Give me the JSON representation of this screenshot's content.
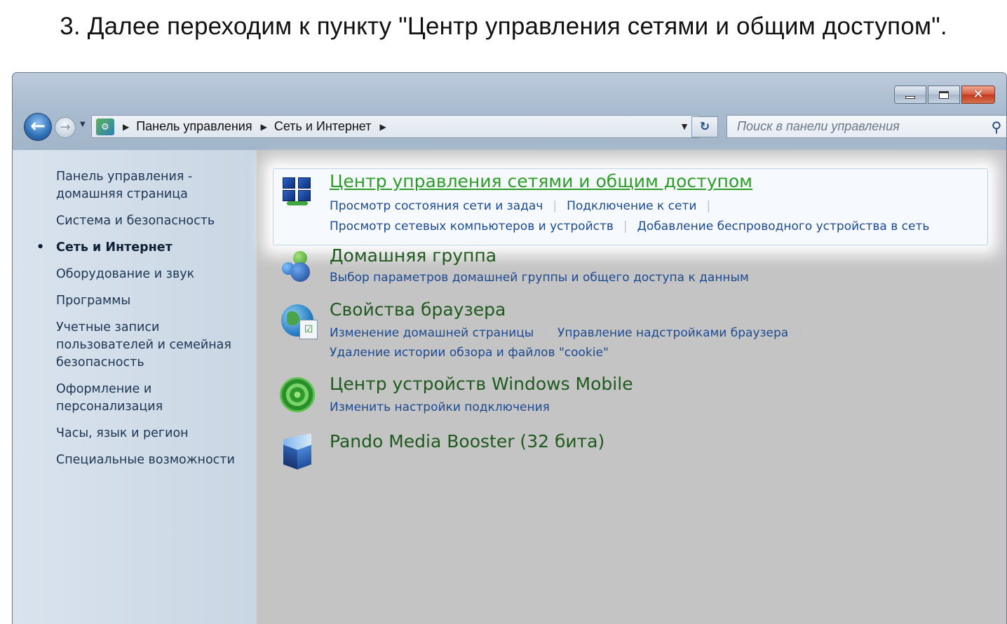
{
  "caption": "3. Далее переходим к пункту \"Центр управления сетями и общим доступом\".",
  "window": {
    "controls": {
      "minimize": "minimize-icon",
      "maximize": "maximize-icon",
      "close": "close-icon"
    }
  },
  "navbar": {
    "breadcrumb": [
      "Панель управления",
      "Сеть и Интернет"
    ],
    "search_placeholder": "Поиск в панели управления"
  },
  "sidebar": {
    "items": [
      {
        "label": "Панель управления - домашняя страница",
        "active": false
      },
      {
        "label": "Система и безопасность",
        "active": false
      },
      {
        "label": "Сеть и Интернет",
        "active": true
      },
      {
        "label": "Оборудование и звук",
        "active": false
      },
      {
        "label": "Программы",
        "active": false
      },
      {
        "label": "Учетные записи пользователей и семейная безопасность",
        "active": false
      },
      {
        "label": "Оформление и персонализация",
        "active": false
      },
      {
        "label": "Часы, язык и регион",
        "active": false
      },
      {
        "label": "Специальные возможности",
        "active": false
      }
    ]
  },
  "categories": [
    {
      "title": "Центр управления сетями и общим доступом",
      "icon": "network-center-icon",
      "highlighted": true,
      "link_rows": [
        [
          "Просмотр состояния сети и задач",
          "Подключение к сети"
        ],
        [
          "Просмотр сетевых компьютеров и устройств",
          "Добавление беспроводного устройства в сеть"
        ]
      ]
    },
    {
      "title": "Домашняя группа",
      "icon": "homegroup-icon",
      "highlighted": false,
      "link_rows": [
        [
          "Выбор параметров домашней группы и общего доступа к данным"
        ]
      ]
    },
    {
      "title": "Свойства браузера",
      "icon": "internet-options-icon",
      "highlighted": false,
      "link_rows": [
        [
          "Изменение домашней страницы",
          "Управление надстройками браузера"
        ],
        [
          "Удаление истории обзора и файлов \"cookie\""
        ]
      ]
    },
    {
      "title": "Центр устройств Windows Mobile",
      "icon": "windows-mobile-icon",
      "highlighted": false,
      "link_rows": [
        [
          "Изменить настройки подключения"
        ]
      ]
    },
    {
      "title": "Pando Media Booster (32 бита)",
      "icon": "pando-icon",
      "highlighted": false,
      "link_rows": []
    }
  ],
  "colors": {
    "title_green": "#1e5a1e",
    "title_hot_green": "#2e9c28",
    "link_blue": "#1b4a92",
    "content_bg": "#c4c4c4"
  }
}
